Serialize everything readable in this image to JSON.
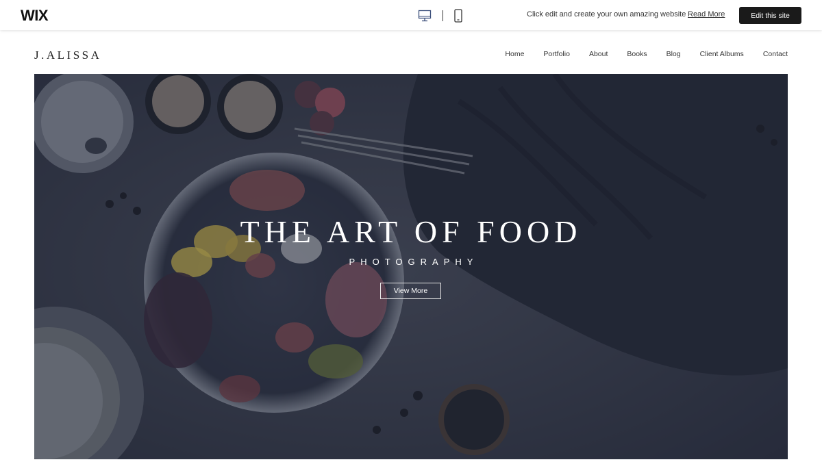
{
  "wix_bar": {
    "logo": "WIX",
    "desktop_icon": "desktop-monitor-icon",
    "mobile_icon": "mobile-phone-icon",
    "promo_text": "Click edit and create your own amazing website",
    "read_more_label": "Read More",
    "edit_button_label": "Edit this site"
  },
  "site": {
    "logo": "J.ALISSA",
    "nav": [
      "Home",
      "Portfolio",
      "About",
      "Books",
      "Blog",
      "Client Albums",
      "Contact"
    ]
  },
  "hero": {
    "title": "THE ART OF FOOD",
    "subtitle": "PHOTOGRAPHY",
    "button_label": "View More"
  },
  "colors": {
    "edit_button_bg": "#1a1a1a",
    "hero_tint": "#2b2f3e",
    "text_dark": "#222222"
  }
}
